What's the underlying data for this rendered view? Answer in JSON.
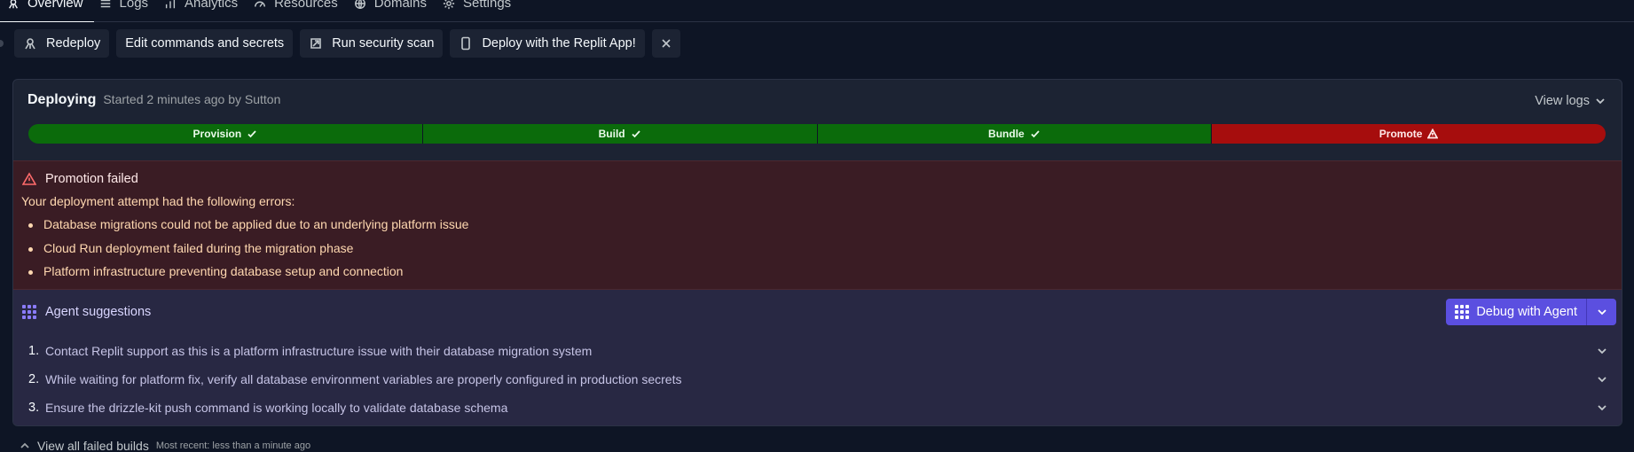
{
  "tabs": [
    {
      "label": "Overview",
      "icon": "deployments-icon",
      "active": true
    },
    {
      "label": "Logs",
      "icon": "list-icon"
    },
    {
      "label": "Analytics",
      "icon": "bar-chart-icon"
    },
    {
      "label": "Resources",
      "icon": "gauge-icon"
    },
    {
      "label": "Domains",
      "icon": "globe-icon"
    },
    {
      "label": "Settings",
      "icon": "gear-icon"
    }
  ],
  "toolbar": {
    "redeploy": "Redeploy",
    "edit": "Edit commands and secrets",
    "security": "Run security scan",
    "app": "Deploy with the Replit App!"
  },
  "deployment": {
    "status": "Deploying",
    "subtitle": "Started 2 minutes ago by Sutton",
    "view_logs": "View logs"
  },
  "pipeline": [
    {
      "label": "Provision",
      "state": "success"
    },
    {
      "label": "Build",
      "state": "success"
    },
    {
      "label": "Bundle",
      "state": "success"
    },
    {
      "label": "Promote",
      "state": "failed"
    }
  ],
  "error": {
    "title": "Promotion failed",
    "intro": "Your deployment attempt had the following errors:",
    "items": [
      "Database migrations could not be applied due to an underlying platform issue",
      "Cloud Run deployment failed during the migration phase",
      "Platform infrastructure preventing database setup and connection"
    ]
  },
  "agent": {
    "title": "Agent suggestions",
    "debug_button": "Debug with Agent",
    "suggestions": [
      {
        "num": "1.",
        "text": "Contact Replit support as this is a platform infrastructure issue with their database migration system"
      },
      {
        "num": "2.",
        "text": "While waiting for platform fix, verify all database environment variables are properly configured in production secrets"
      },
      {
        "num": "3.",
        "text": "Ensure the drizzle-kit push command is working locally to validate database schema"
      }
    ]
  },
  "failed_builds": {
    "label": "View all failed builds",
    "sub": "Most recent: less than a minute ago"
  },
  "colors": {
    "background": "#0e1525",
    "success": "#0b6b0b",
    "failed": "#a60d0d",
    "agent_accent": "#5b4fe0"
  }
}
